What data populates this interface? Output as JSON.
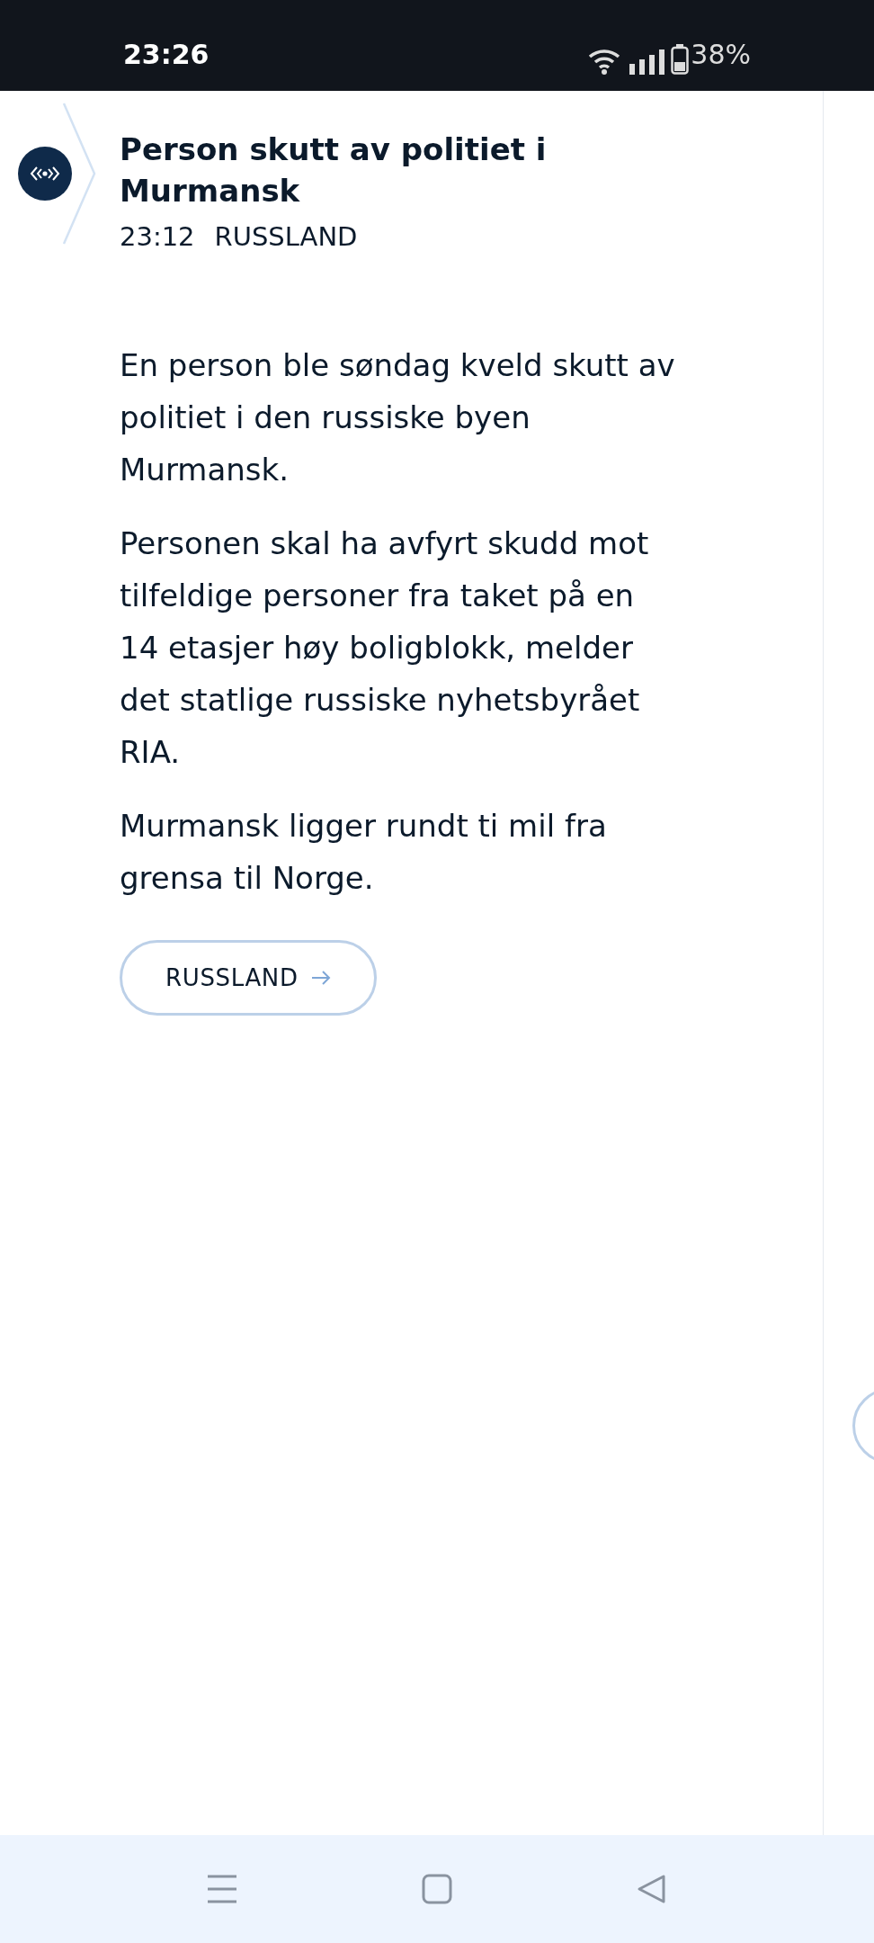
{
  "status_bar": {
    "time": "23:26",
    "battery": "38%"
  },
  "live_card": {
    "title": "Person skutt av politiet i Murmansk",
    "time": "23:12",
    "category": "RUSSLAND",
    "paragraphs": [
      "En person ble søndag kveld skutt av politiet i den russiske byen Murmansk.",
      "Personen skal ha avfyrt skudd mot tilfeldige personer fra taket på en 14 etasjer høy boligblokk, melder det statlige russiske nyhetsbyrået RIA.",
      "Murmansk ligger rundt ti mil fra grensa til Norge."
    ],
    "tag_button": "RUSSLAND"
  }
}
